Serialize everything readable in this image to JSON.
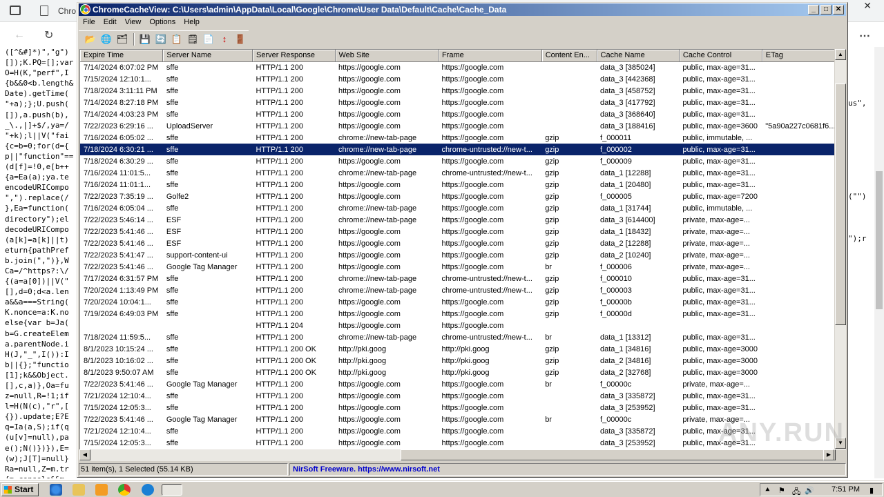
{
  "background": {
    "tab_title": "Chro",
    "code_lines": [
      "([^&#]*)\",\"g\")",
      "[]);K.PQ=[];var",
      "O=H(K,\"perf\",I",
      "{b&&0<b.length&",
      "Date).getTime(",
      "\"+a);};U.push(",
      "[]),a.push(b),",
      "_\\.,|]+$/,ya=/",
      "\"+k);l||V(\"fai",
      "{c=b=0;for(d={",
      "p||\"function\"==",
      "(d[f]=!0,e[b++",
      "{a=Ea(a);ya.te",
      "encodeURICompo",
      "\",\").replace(/",
      "},Ea=function(",
      "directory\");el",
      "decodeURICompo",
      "(a[k]=a[k]||t)",
      "eturn{pathPref",
      "b.join(\",\")},W",
      "Ca=/^https?:\\/",
      "{(a=a[0])||V(\"",
      "[],d=0;d<a.len",
      "a&&a===String(",
      "K.nonce=a:K.no",
      "else{var b=Ja(",
      "b=G.createElem",
      "a.parentNode.i",
      "H(J,\"_\",I()):I",
      "b||{};\"functio",
      "[1];k&&Object.",
      "[],c,a)},Oa=fu",
      "z=null,R=!1;if",
      "l=H(N(c),\"r\",[",
      "{}).update;E?E",
      "q=Ia(a,S);if(q",
      "(u[v]=null),pa",
      "e();N()})}),E=",
      "(w);J[T]=null}",
      "Ra=null,Z=m.tr",
      "{m.console&&m."
    ],
    "right_code": [
      "us\",",
      "(\"\")",
      "\");r"
    ]
  },
  "window": {
    "title": "ChromeCacheView:  C:\\Users\\admin\\AppData\\Local\\Google\\Chrome\\User Data\\Default\\Cache\\Cache_Data",
    "menus": [
      "File",
      "Edit",
      "View",
      "Options",
      "Help"
    ],
    "columns": [
      "Expire Time",
      "Server Name",
      "Server Response",
      "Web Site",
      "Frame",
      "Content En...",
      "Cache Name",
      "Cache Control",
      "ETag"
    ],
    "rows": [
      [
        "7/14/2024 6:07:02 PM",
        "sffe",
        "HTTP/1.1 200",
        "https://google.com",
        "https://google.com",
        "",
        "data_3  [385024]",
        "public, max-age=31...",
        ""
      ],
      [
        "7/15/2024 12:10:1...",
        "sffe",
        "HTTP/1.1 200",
        "https://google.com",
        "https://google.com",
        "",
        "data_3  [442368]",
        "public, max-age=31...",
        ""
      ],
      [
        "7/18/2024 3:11:11 PM",
        "sffe",
        "HTTP/1.1 200",
        "https://google.com",
        "https://google.com",
        "",
        "data_3  [458752]",
        "public, max-age=31...",
        ""
      ],
      [
        "7/14/2024 8:27:18 PM",
        "sffe",
        "HTTP/1.1 200",
        "https://google.com",
        "https://google.com",
        "",
        "data_3  [417792]",
        "public, max-age=31...",
        ""
      ],
      [
        "7/14/2024 4:03:23 PM",
        "sffe",
        "HTTP/1.1 200",
        "https://google.com",
        "https://google.com",
        "",
        "data_3  [368640]",
        "public, max-age=31...",
        ""
      ],
      [
        "7/22/2023 6:29:16 ...",
        "UploadServer",
        "HTTP/1.1 200",
        "https://google.com",
        "https://google.com",
        "",
        "data_3  [188416]",
        "public, max-age=3600",
        "\"5a90a227c0681f6..."
      ],
      [
        "7/16/2024 6:05:02 ...",
        "sffe",
        "HTTP/1.1 200",
        "chrome://new-tab-page",
        "https://google.com",
        "gzip",
        "f_000011",
        "public, immutable, ...",
        ""
      ],
      [
        "7/18/2024 6:30:21 ...",
        "sffe",
        "HTTP/1.1 200",
        "chrome://new-tab-page",
        "chrome-untrusted://new-t...",
        "gzip",
        "f_000002",
        "public, max-age=31...",
        ""
      ],
      [
        "7/18/2024 6:30:29 ...",
        "sffe",
        "HTTP/1.1 200",
        "https://google.com",
        "https://google.com",
        "gzip",
        "f_000009",
        "public, max-age=31...",
        ""
      ],
      [
        "7/16/2024 11:01:5...",
        "sffe",
        "HTTP/1.1 200",
        "chrome://new-tab-page",
        "chrome-untrusted://new-t...",
        "gzip",
        "data_1  [12288]",
        "public, max-age=31...",
        ""
      ],
      [
        "7/16/2024 11:01:1...",
        "sffe",
        "HTTP/1.1 200",
        "https://google.com",
        "https://google.com",
        "gzip",
        "data_1  [20480]",
        "public, max-age=31...",
        ""
      ],
      [
        "7/22/2023 7:35:19 ...",
        "Golfe2",
        "HTTP/1.1 200",
        "https://google.com",
        "https://google.com",
        "gzip",
        "f_000005",
        "public, max-age=7200",
        ""
      ],
      [
        "7/16/2024 6:05:04 ...",
        "sffe",
        "HTTP/1.1 200",
        "chrome://new-tab-page",
        "https://google.com",
        "gzip",
        "data_1  [31744]",
        "public, immutable, ...",
        ""
      ],
      [
        "7/22/2023 5:46:14 ...",
        "ESF",
        "HTTP/1.1 200",
        "chrome://new-tab-page",
        "https://google.com",
        "gzip",
        "data_3  [614400]",
        "private, max-age=...",
        ""
      ],
      [
        "7/22/2023 5:41:46 ...",
        "ESF",
        "HTTP/1.1 200",
        "https://google.com",
        "https://google.com",
        "gzip",
        "data_1  [18432]",
        "private, max-age=...",
        ""
      ],
      [
        "7/22/2023 5:41:46 ...",
        "ESF",
        "HTTP/1.1 200",
        "https://google.com",
        "https://google.com",
        "gzip",
        "data_2  [12288]",
        "private, max-age=...",
        ""
      ],
      [
        "7/22/2023 5:41:47 ...",
        "support-content-ui",
        "HTTP/1.1 200",
        "https://google.com",
        "https://google.com",
        "gzip",
        "data_2  [10240]",
        "private, max-age=...",
        ""
      ],
      [
        "7/22/2023 5:41:46 ...",
        "Google Tag Manager",
        "HTTP/1.1 200",
        "https://google.com",
        "https://google.com",
        "br",
        "f_000006",
        "private, max-age=...",
        ""
      ],
      [
        "7/17/2024 6:31:57 PM",
        "sffe",
        "HTTP/1.1 200",
        "chrome://new-tab-page",
        "chrome-untrusted://new-t...",
        "gzip",
        "f_000010",
        "public, max-age=31...",
        ""
      ],
      [
        "7/20/2024 1:13:49 PM",
        "sffe",
        "HTTP/1.1 200",
        "chrome://new-tab-page",
        "chrome-untrusted://new-t...",
        "gzip",
        "f_000003",
        "public, max-age=31...",
        ""
      ],
      [
        "7/20/2024 10:04:1...",
        "sffe",
        "HTTP/1.1 200",
        "https://google.com",
        "https://google.com",
        "gzip",
        "f_00000b",
        "public, max-age=31...",
        ""
      ],
      [
        "7/19/2024 6:49:03 PM",
        "sffe",
        "HTTP/1.1 200",
        "https://google.com",
        "https://google.com",
        "gzip",
        "f_00000d",
        "public, max-age=31...",
        ""
      ],
      [
        "",
        "",
        "HTTP/1.1 204",
        "https://google.com",
        "https://google.com",
        "",
        "",
        "",
        ""
      ],
      [
        "7/18/2024 11:59:5...",
        "sffe",
        "HTTP/1.1 200",
        "chrome://new-tab-page",
        "chrome-untrusted://new-t...",
        "br",
        "data_1  [13312]",
        "public, max-age=31...",
        ""
      ],
      [
        "8/1/2023 10:15:24 ...",
        "sffe",
        "HTTP/1.1 200 OK",
        "http://pki.goog",
        "http://pki.goog",
        "gzip",
        "data_1  [34816]",
        "public, max-age=3000",
        ""
      ],
      [
        "8/1/2023 10:16:02 ...",
        "sffe",
        "HTTP/1.1 200 OK",
        "http://pki.goog",
        "http://pki.goog",
        "gzip",
        "data_2  [34816]",
        "public, max-age=3000",
        ""
      ],
      [
        "8/1/2023 9:50:07 AM",
        "sffe",
        "HTTP/1.1 200 OK",
        "http://pki.goog",
        "http://pki.goog",
        "gzip",
        "data_2  [32768]",
        "public, max-age=3000",
        ""
      ],
      [
        "7/22/2023 5:41:46 ...",
        "Google Tag Manager",
        "HTTP/1.1 200",
        "https://google.com",
        "https://google.com",
        "br",
        "f_00000c",
        "private, max-age=...",
        ""
      ],
      [
        "7/21/2024 12:10:4...",
        "sffe",
        "HTTP/1.1 200",
        "https://google.com",
        "https://google.com",
        "",
        "data_3  [335872]",
        "public, max-age=31...",
        ""
      ],
      [
        "7/15/2024 12:05:3...",
        "sffe",
        "HTTP/1.1 200",
        "https://google.com",
        "https://google.com",
        "",
        "data_3  [253952]",
        "public, max-age=31...",
        ""
      ],
      [
        "7/22/2023 5:41:46 ...",
        "Google Tag Manager",
        "HTTP/1.1 200",
        "https://google.com",
        "https://google.com",
        "br",
        "f_00000c",
        "private, max-age=...",
        ""
      ],
      [
        "7/21/2024 12:10:4...",
        "sffe",
        "HTTP/1.1 200",
        "https://google.com",
        "https://google.com",
        "",
        "data_3  [335872]",
        "public, max-age=31...",
        ""
      ],
      [
        "7/15/2024 12:05:3...",
        "sffe",
        "HTTP/1.1 200",
        "https://google.com",
        "https://google.com",
        "",
        "data_3  [253952]",
        "public, max-age=31...",
        ""
      ]
    ],
    "selected_row": 7,
    "status_left": "51 item(s), 1 Selected  (55.14 KB)",
    "status_right": "NirSoft Freeware.  https://www.nirsoft.net"
  },
  "taskbar": {
    "start": "Start",
    "clock": "7:51 PM"
  },
  "colors": {
    "selection": "#0a246a",
    "title_start": "#0a246a",
    "title_end": "#a6caf0",
    "link": "#0000cc"
  }
}
